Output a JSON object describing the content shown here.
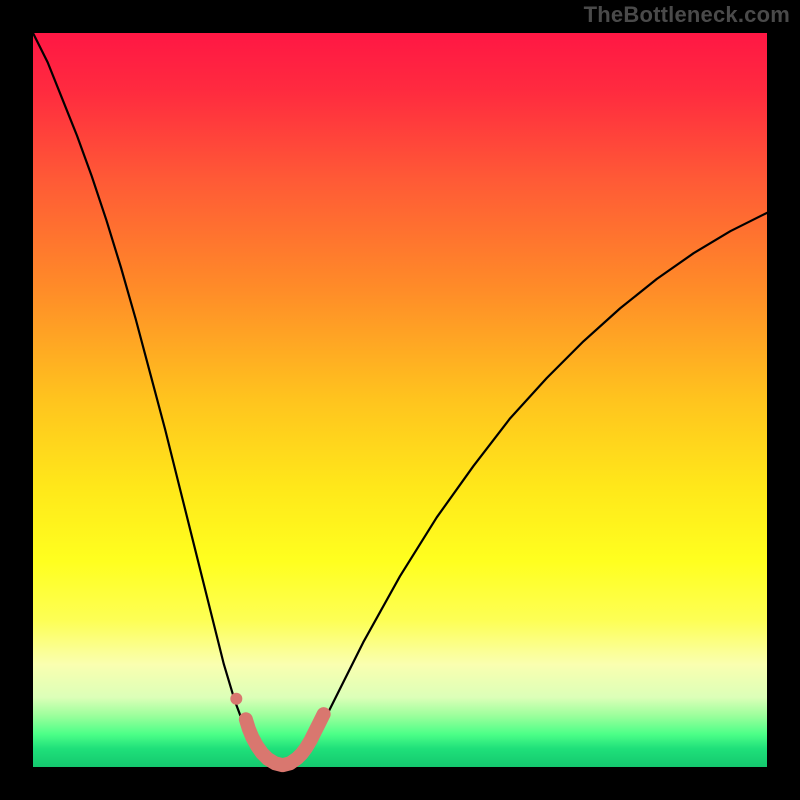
{
  "watermark": "TheBottleneck.com",
  "chart_data": {
    "type": "line",
    "title": "",
    "xlabel": "",
    "ylabel": "",
    "xlim": [
      0,
      100
    ],
    "ylim": [
      0,
      100
    ],
    "background_gradient": {
      "stops": [
        {
          "offset": 0.0,
          "color": "#ff1744"
        },
        {
          "offset": 0.08,
          "color": "#ff2b3f"
        },
        {
          "offset": 0.2,
          "color": "#ff5a36"
        },
        {
          "offset": 0.35,
          "color": "#ff8c28"
        },
        {
          "offset": 0.5,
          "color": "#ffc41e"
        },
        {
          "offset": 0.62,
          "color": "#ffe81a"
        },
        {
          "offset": 0.72,
          "color": "#ffff1f"
        },
        {
          "offset": 0.8,
          "color": "#fdff55"
        },
        {
          "offset": 0.86,
          "color": "#faffb0"
        },
        {
          "offset": 0.905,
          "color": "#dcffb8"
        },
        {
          "offset": 0.93,
          "color": "#9cff9c"
        },
        {
          "offset": 0.955,
          "color": "#4dff88"
        },
        {
          "offset": 0.975,
          "color": "#1fe07a"
        },
        {
          "offset": 1.0,
          "color": "#14c86e"
        }
      ]
    },
    "series": [
      {
        "name": "bottleneck-curve",
        "type": "line",
        "color": "#000000",
        "x": [
          0,
          2,
          4,
          6,
          8,
          10,
          12,
          14,
          16,
          18,
          20,
          22,
          24,
          26,
          27.5,
          29,
          30.5,
          32,
          33,
          34,
          35,
          36,
          36.5,
          38,
          40,
          42,
          45,
          50,
          55,
          60,
          65,
          70,
          75,
          80,
          85,
          90,
          95,
          100
        ],
        "y": [
          100,
          96,
          91,
          86,
          80.5,
          74.5,
          68,
          61,
          53.5,
          46,
          38,
          30,
          22,
          14,
          9,
          5,
          2.3,
          0.8,
          0.25,
          0.1,
          0.25,
          0.8,
          1.5,
          3.5,
          7,
          11,
          17,
          26,
          34,
          41,
          47.5,
          53,
          58,
          62.5,
          66.5,
          70,
          73,
          75.5
        ]
      },
      {
        "name": "bottom-marker",
        "type": "line",
        "color": "#d9776f",
        "stroke_width": 14,
        "x": [
          29.0,
          29.4,
          29.9,
          30.5,
          31.2,
          32.0,
          33.0,
          34.0,
          35.0,
          36.0,
          36.6,
          37.2,
          37.8,
          38.4,
          39.0,
          39.6
        ],
        "y": [
          6.5,
          5.2,
          4.0,
          2.9,
          1.9,
          1.1,
          0.5,
          0.25,
          0.5,
          1.2,
          1.8,
          2.6,
          3.6,
          4.8,
          6.0,
          7.2
        ]
      }
    ],
    "markers": [
      {
        "name": "left-dot",
        "x": 27.7,
        "y": 9.3,
        "r": 6,
        "color": "#d9776f"
      }
    ]
  }
}
